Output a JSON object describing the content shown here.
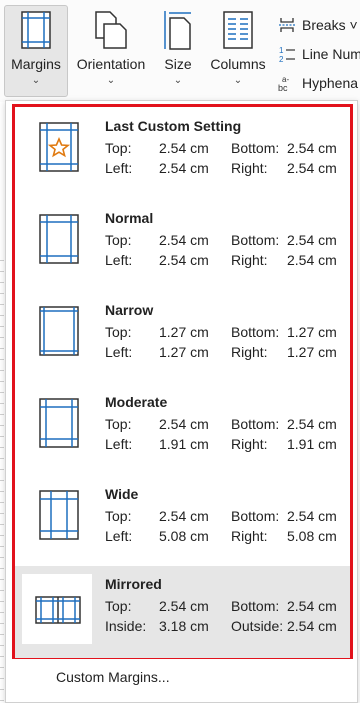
{
  "ribbon": {
    "margins_label": "Margins",
    "orientation_label": "Orientation",
    "size_label": "Size",
    "columns_label": "Columns",
    "breaks_label": "Breaks ˅",
    "line_numbers_label": "Line Num",
    "hyphenation_label": "Hyphena"
  },
  "menu": {
    "options": [
      {
        "title": "Last Custom Setting",
        "k1": "Top:",
        "v1": "2.54 cm",
        "k2": "Bottom:",
        "v2": "2.54 cm",
        "k3": "Left:",
        "v3": "2.54 cm",
        "k4": "Right:",
        "v4": "2.54 cm"
      },
      {
        "title": "Normal",
        "k1": "Top:",
        "v1": "2.54 cm",
        "k2": "Bottom:",
        "v2": "2.54 cm",
        "k3": "Left:",
        "v3": "2.54 cm",
        "k4": "Right:",
        "v4": "2.54 cm"
      },
      {
        "title": "Narrow",
        "k1": "Top:",
        "v1": "1.27 cm",
        "k2": "Bottom:",
        "v2": "1.27 cm",
        "k3": "Left:",
        "v3": "1.27 cm",
        "k4": "Right:",
        "v4": "1.27 cm"
      },
      {
        "title": "Moderate",
        "k1": "Top:",
        "v1": "2.54 cm",
        "k2": "Bottom:",
        "v2": "2.54 cm",
        "k3": "Left:",
        "v3": "1.91 cm",
        "k4": "Right:",
        "v4": "1.91 cm"
      },
      {
        "title": "Wide",
        "k1": "Top:",
        "v1": "2.54 cm",
        "k2": "Bottom:",
        "v2": "2.54 cm",
        "k3": "Left:",
        "v3": "5.08 cm",
        "k4": "Right:",
        "v4": "5.08 cm"
      },
      {
        "title": "Mirrored",
        "k1": "Top:",
        "v1": "2.54 cm",
        "k2": "Bottom:",
        "v2": "2.54 cm",
        "k3": "Inside:",
        "v3": "3.18 cm",
        "k4": "Outside:",
        "v4": "2.54 cm"
      }
    ],
    "custom_margins_label": "Custom Margins..."
  },
  "colors": {
    "accent": "#1e6fbf",
    "highlight_border": "#e2121c",
    "star": "#e07a10"
  }
}
